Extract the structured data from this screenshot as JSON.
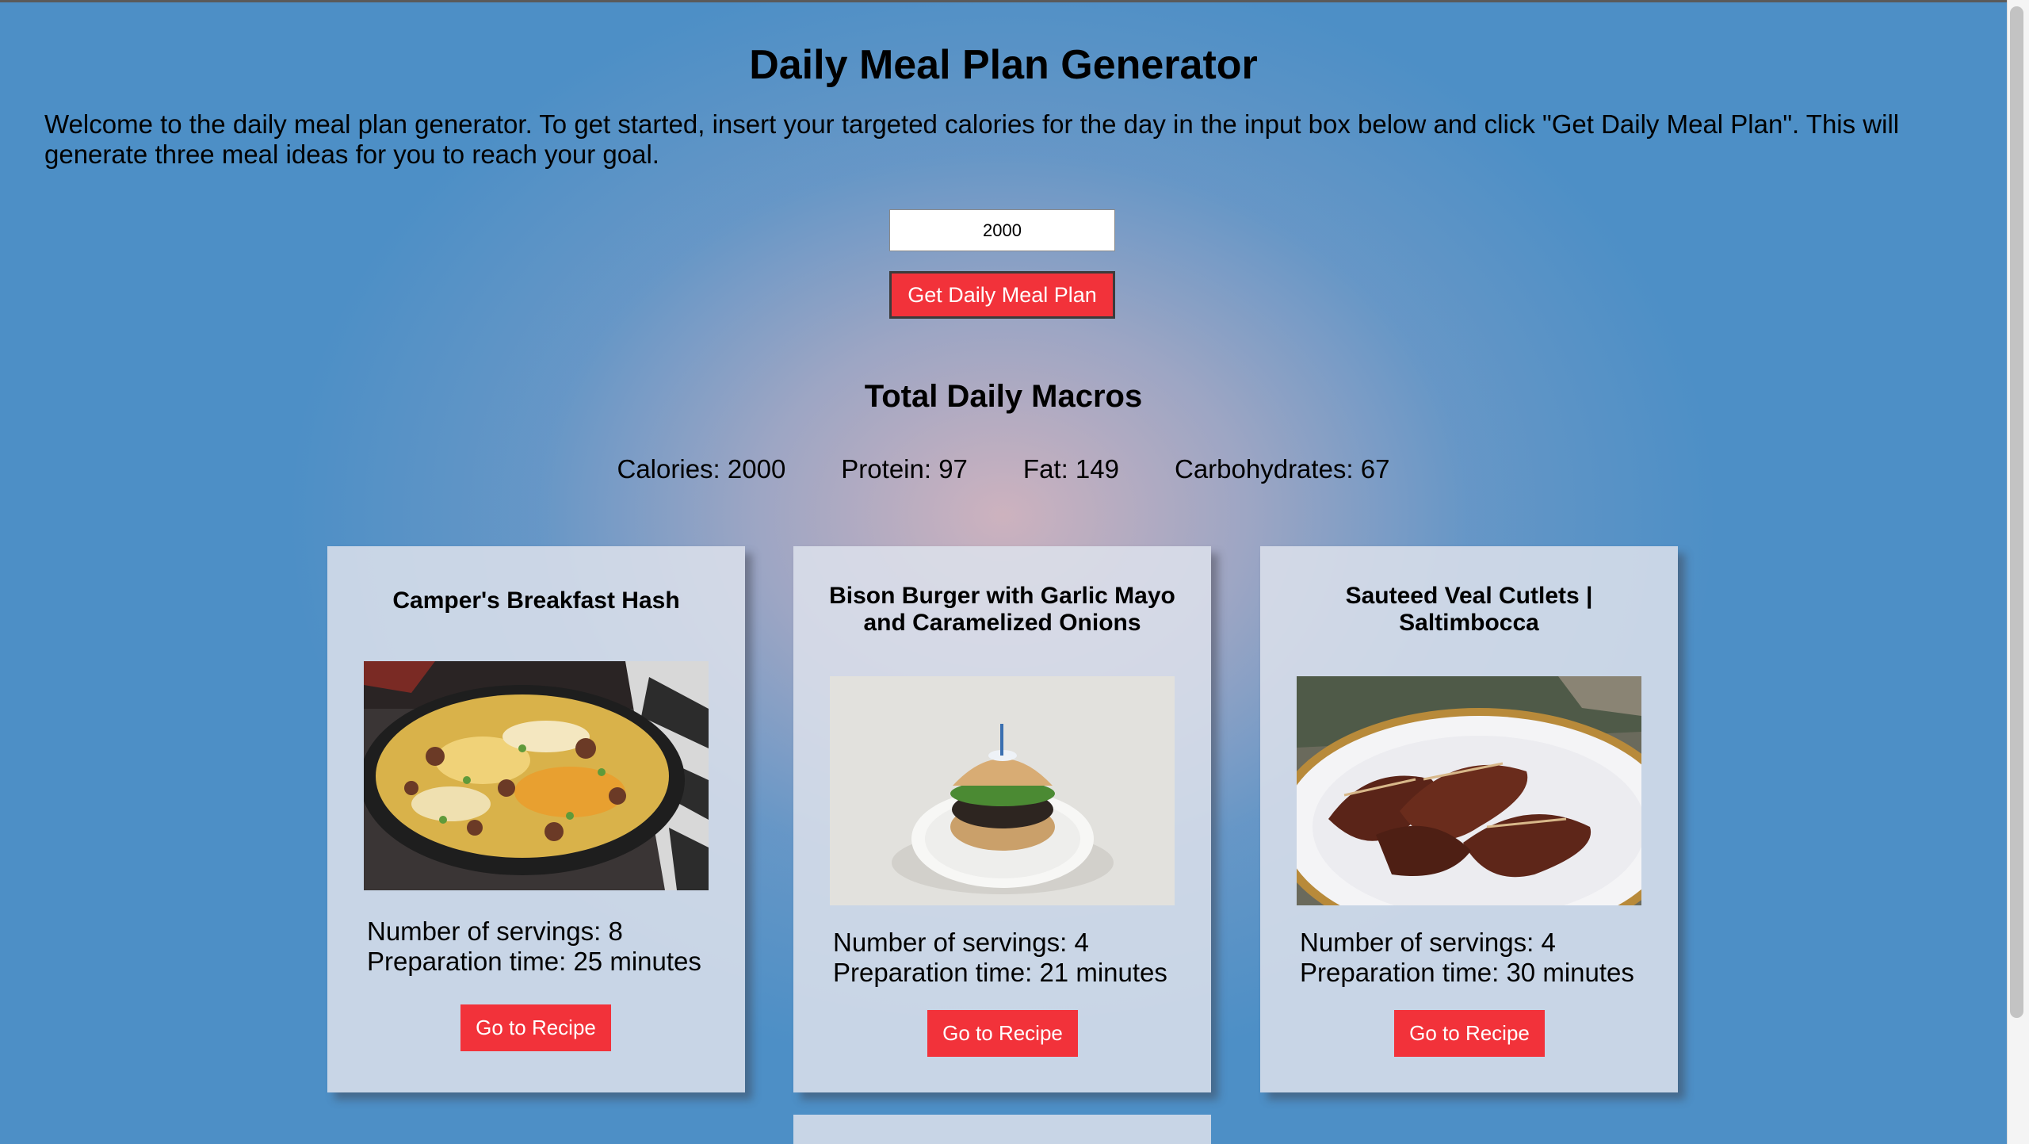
{
  "header": {
    "title": "Daily Meal Plan Generator",
    "intro": "Welcome to the daily meal plan generator. To get started, insert your targeted calories for the day in the input box below and click \"Get Daily Meal Plan\". This will generate three meal ideas for you to reach your goal."
  },
  "form": {
    "calories_value": "2000",
    "button_label": "Get Daily Meal Plan"
  },
  "macros": {
    "title": "Total Daily Macros",
    "calories": "Calories: 2000",
    "protein": "Protein: 97",
    "fat": "Fat: 149",
    "carbs": "Carbohydrates: 67"
  },
  "meals": [
    {
      "title": "Camper's Breakfast Hash",
      "servings": "Number of servings: 8",
      "prep": "Preparation time: 25 minutes",
      "button": "Go to Recipe"
    },
    {
      "title": "Bison Burger with Garlic Mayo and Caramelized Onions",
      "servings": "Number of servings: 4",
      "prep": "Preparation time: 21 minutes",
      "button": "Go to Recipe"
    },
    {
      "title": "Sauteed Veal Cutlets | Saltimbocca",
      "servings": "Number of servings: 4",
      "prep": "Preparation time: 30 minutes",
      "button": "Go to Recipe"
    }
  ],
  "colors": {
    "accent_button": "#f2323a",
    "background_blue": "#4d8fc6",
    "card_background": "#dce1eb"
  }
}
